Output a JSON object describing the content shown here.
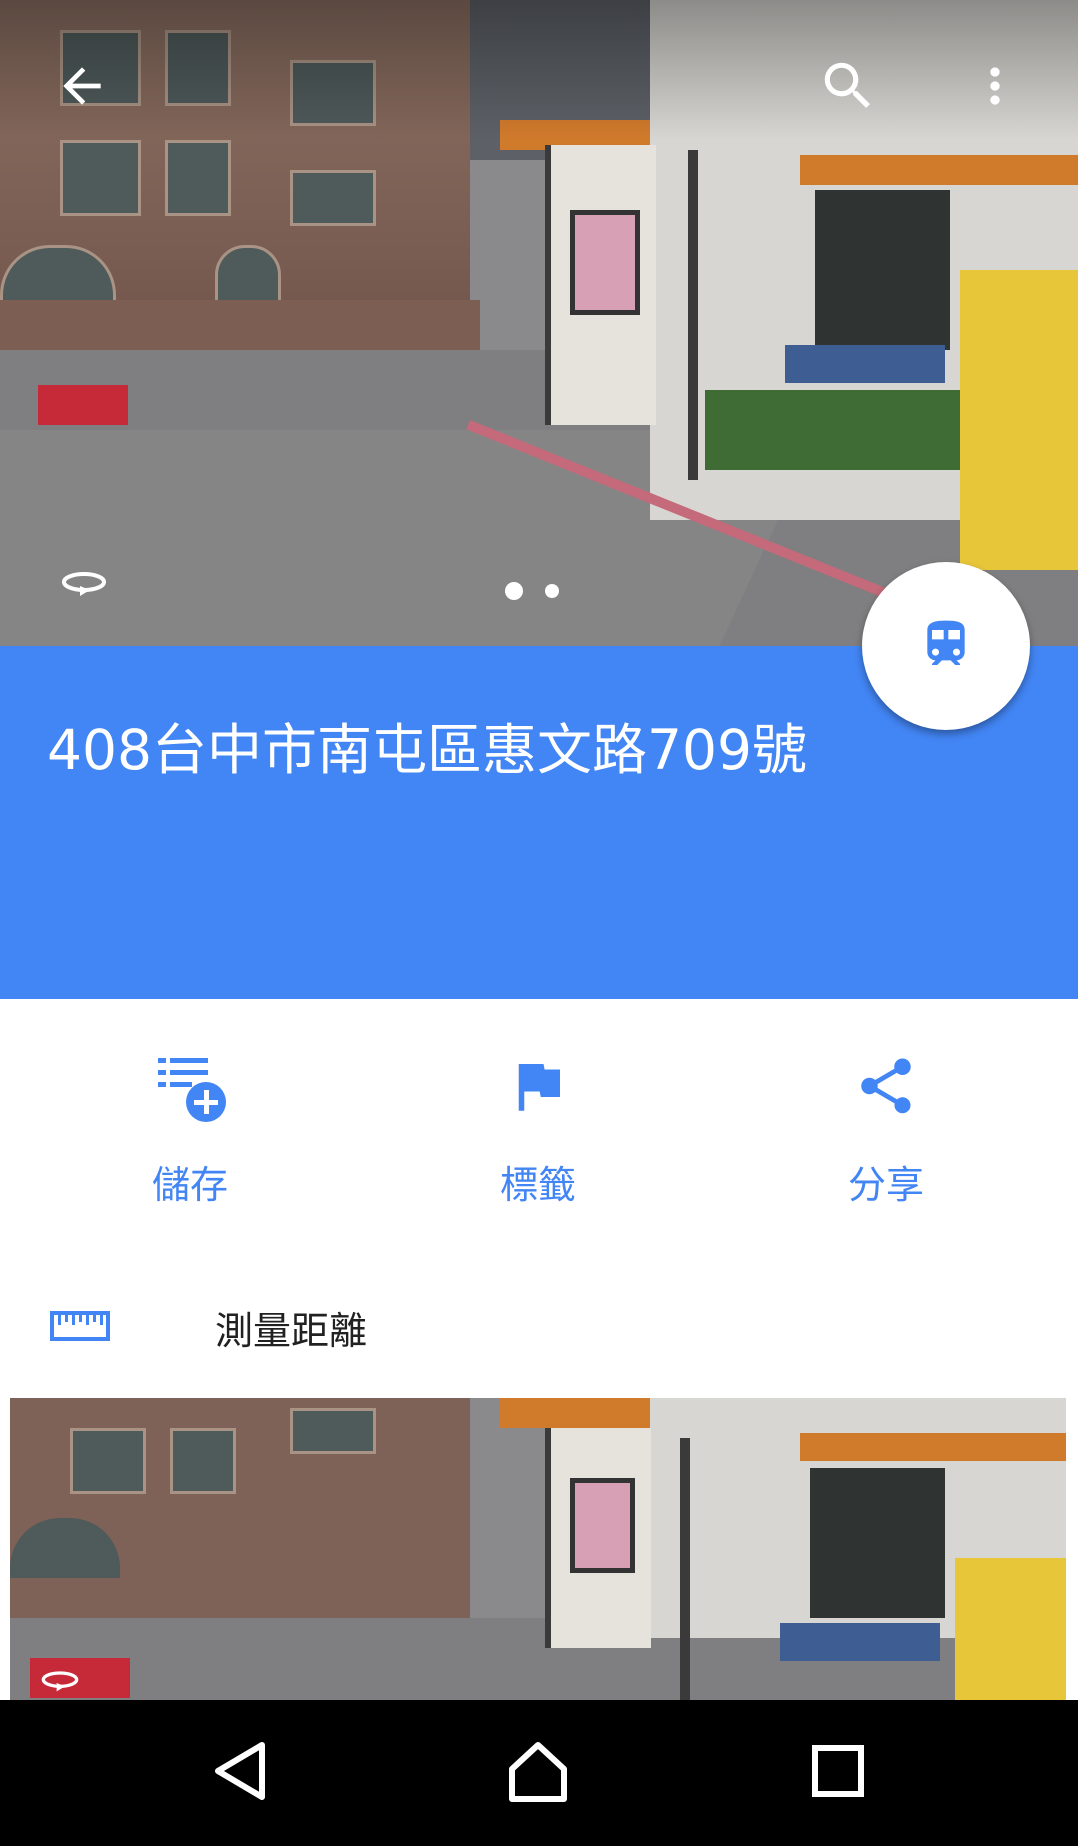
{
  "header": {
    "back_icon": "arrow-left-icon",
    "search_icon": "search-icon",
    "more_icon": "more-vert-icon",
    "rotate_icon": "360-rotate-icon"
  },
  "place": {
    "address": "408台中市南屯區惠文路709號"
  },
  "fab": {
    "icon": "transit-train-icon"
  },
  "actions": [
    {
      "label": "儲存",
      "icon": "playlist-add-icon"
    },
    {
      "label": "標籤",
      "icon": "flag-icon"
    },
    {
      "label": "分享",
      "icon": "share-icon"
    }
  ],
  "tools": {
    "measure_label": "測量距離",
    "measure_icon": "ruler-icon"
  },
  "system_nav": {
    "back_icon": "nav-back-icon",
    "home_icon": "nav-home-icon",
    "recents_icon": "nav-recents-icon"
  },
  "colors": {
    "accent": "#4285f4",
    "panel_text": "#ffffff",
    "navbar": "#000000"
  }
}
